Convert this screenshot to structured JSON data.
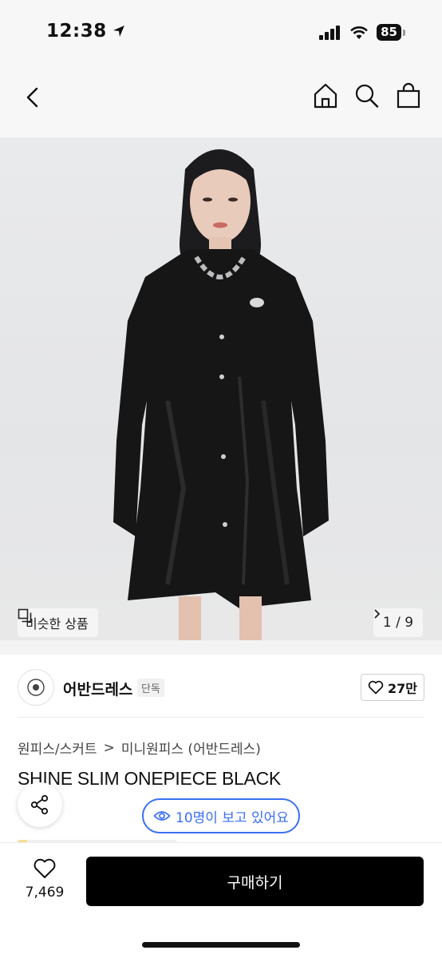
{
  "status_bar": {
    "time": "12:38",
    "battery": "85"
  },
  "nav": {
    "icons": [
      "back-chevron-icon",
      "home-icon",
      "search-icon",
      "shopping-bag-icon"
    ]
  },
  "hero": {
    "similar_label": "비슷한 상품",
    "page_indicator": "1 / 9"
  },
  "brand": {
    "name": "어반드레스",
    "badge": "단독",
    "likes": "27만"
  },
  "product": {
    "breadcrumb_1": "원피스/스커트",
    "breadcrumb_sep": ">",
    "breadcrumb_2": "미니원피스 (어반드레스)",
    "title": "SHINE SLIM ONEPIECE BLACK"
  },
  "viewers": {
    "label": "10명이 보고 있어요"
  },
  "bottom": {
    "wish_count": "7,469",
    "buy_label": "구매하기"
  },
  "colors": {
    "accent_blue": "#3b6ff5",
    "buy_button": "#000000"
  }
}
